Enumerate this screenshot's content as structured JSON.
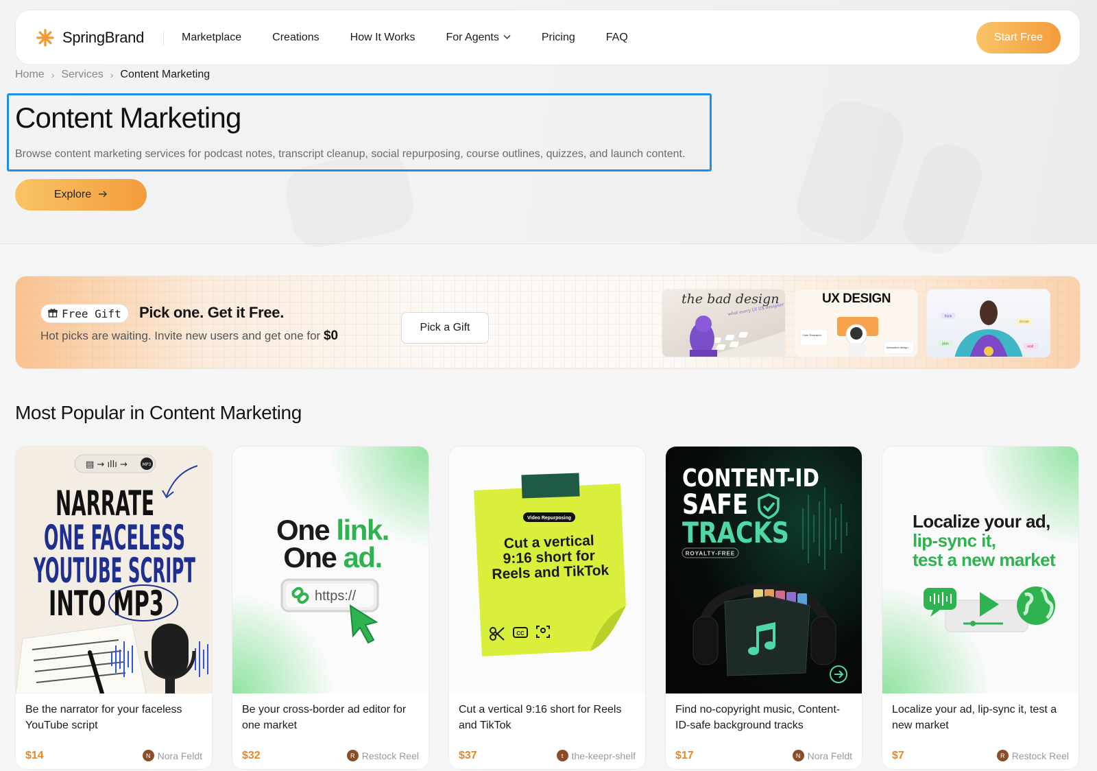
{
  "nav": {
    "brand": "SpringBrand",
    "links": [
      "Marketplace",
      "Creations",
      "How It Works",
      "For Agents",
      "Pricing",
      "FAQ"
    ],
    "cta": "Start Free"
  },
  "breadcrumb": [
    "Home",
    "Services",
    "Content Marketing"
  ],
  "hero": {
    "title": "Content Marketing",
    "description": "Browse content marketing services for podcast notes, transcript cleanup, social repurposing, course outlines, quizzes, and launch content.",
    "explore": "Explore"
  },
  "gift": {
    "badge": "Free Gift",
    "title": "Pick one. Get it Free.",
    "subtitle": "Hot picks are waiting. Invite new users and get one for",
    "price": "$0",
    "button": "Pick a Gift",
    "thumbs": [
      {
        "text": "the bad design",
        "sub": "what every UI UX designer should know"
      },
      {
        "text": "UX DESIGN",
        "sub": "User Research",
        "sub2": "Interaction design"
      },
      {
        "tags": [
          "think",
          "iterate",
          "plan",
          "wait"
        ]
      }
    ]
  },
  "section": {
    "title": "Most Popular in Content Marketing"
  },
  "cards": [
    {
      "art": {
        "lines": [
          "NARRATE",
          "ONE FACELESS",
          "YOUTUBE SCRIPT",
          "INTO MP3"
        ],
        "badge": "MP3"
      },
      "title": "Be the narrator for your faceless YouTube script",
      "price": "$14",
      "seller": "Nora Feldt",
      "seller_initial": "N"
    },
    {
      "art": {
        "line1a": "One ",
        "line1b": "link.",
        "line2a": "One ",
        "line2b": "ad.",
        "url": "https://"
      },
      "title": "Be your cross-border ad editor for one market",
      "price": "$32",
      "seller": "Restock Reel",
      "seller_initial": "R"
    },
    {
      "art": {
        "tag": "Video Repurposing",
        "lines": [
          "Cut a vertical",
          "9:16 short for",
          "Reels and TikTok"
        ]
      },
      "title": "Cut a vertical 9:16 short for Reels and TikTok",
      "price": "$37",
      "seller": "the-keepr-shelf",
      "seller_initial": "t"
    },
    {
      "art": {
        "lines": [
          "CONTENT-ID",
          "SAFE",
          "TRACKS"
        ],
        "tag": "ROYALTY-FREE"
      },
      "title": "Find no-copyright music, Content-ID-safe background tracks",
      "price": "$17",
      "seller": "Nora Feldt",
      "seller_initial": "N"
    },
    {
      "art": {
        "lines": [
          "Localize your ad,",
          "lip-sync it,",
          "test a new market"
        ]
      },
      "title": "Localize your ad, lip-sync it, test a new market",
      "price": "$7",
      "seller": "Restock Reel",
      "seller_initial": "R"
    }
  ],
  "colors": {
    "accent_start": "#f8c466",
    "accent_end": "#f39c3c",
    "price": "#f0821e",
    "focus_outline": "#1e8fe8",
    "green": "#2fb350",
    "lime": "#d9ef3c"
  }
}
